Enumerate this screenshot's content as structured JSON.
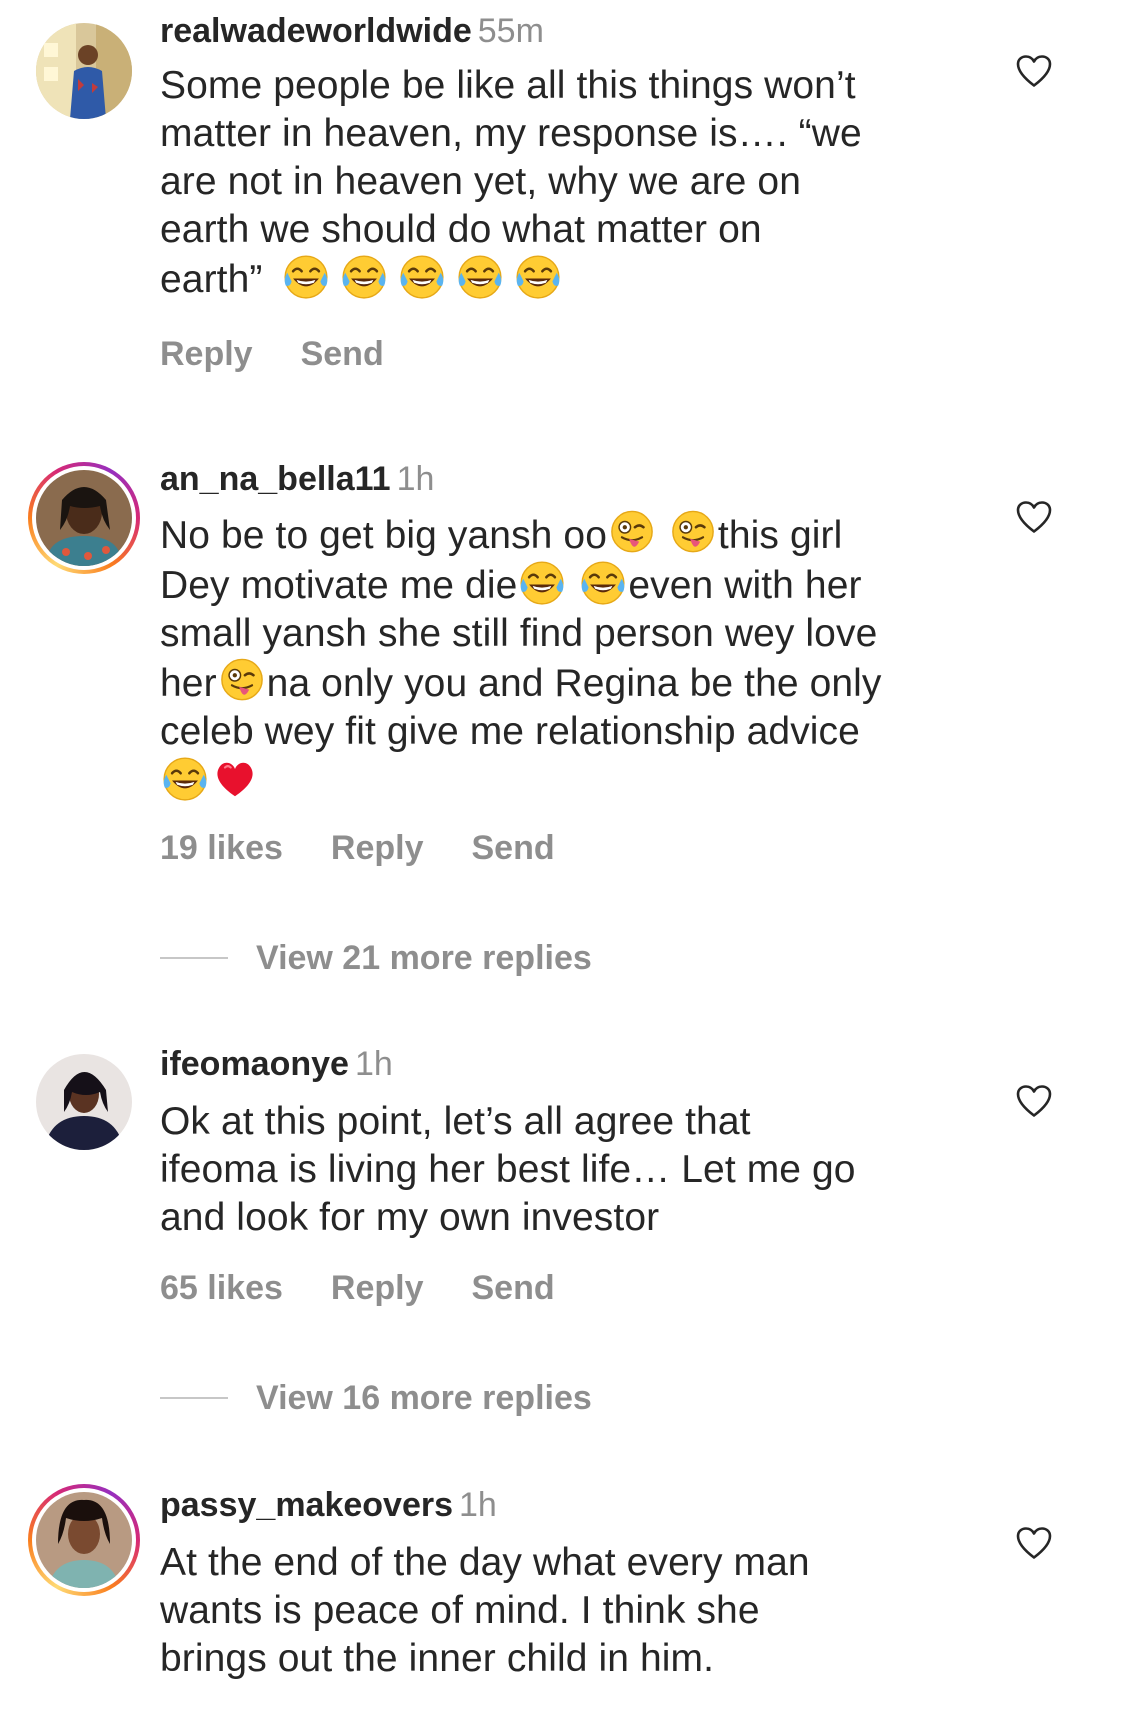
{
  "comments": [
    {
      "username": "realwadeworldwide",
      "time": "55m",
      "lines": [
        "Some people be like all this things won’t",
        "matter in heaven, my response is…. “we",
        "are not in heaven yet, why we are on",
        "earth we should do what matter on",
        "earth”"
      ],
      "likes": "",
      "reply_label": "Reply",
      "send_label": "Send"
    },
    {
      "username": "an_na_bella11",
      "time": "1h",
      "line1a": "No be to get big yansh oo",
      "line1b": "this girl",
      "line2a": "Dey motivate me die",
      "line2b": "even with her",
      "line3": "small yansh she still find person wey love",
      "line4a": "her",
      "line4b": "na only you and Regina be the only",
      "line5": "celeb wey  fit give me relationship advice",
      "likes": "19 likes",
      "reply_label": "Reply",
      "send_label": "Send",
      "view_replies": "View 21 more replies"
    },
    {
      "username": "ifeomaonye",
      "time": "1h",
      "lines": [
        "Ok at this point, let’s all agree that",
        "ifeoma is living her best life… Let me go",
        "and look for my own investor"
      ],
      "likes": "65 likes",
      "reply_label": "Reply",
      "send_label": "Send",
      "view_replies": "View 16 more replies"
    },
    {
      "username": "passy_makeovers",
      "time": "1h",
      "lines": [
        "At the end of the day what every man",
        "wants is peace of mind. I think she",
        "brings out the inner child in him."
      ]
    }
  ],
  "icons": {
    "heart": "heart-outline-icon",
    "laughing": "face-with-tears-of-joy-icon",
    "winking_tongue": "winking-face-with-tongue-icon",
    "red_heart": "red-heart-icon"
  },
  "colors": {
    "text": "#262626",
    "secondary": "#8e8e8e",
    "story_ring": "#d62976"
  }
}
